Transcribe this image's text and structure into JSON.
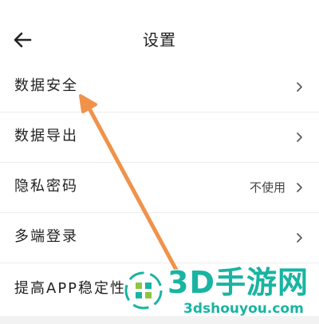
{
  "header": {
    "back_icon": "arrow-left-icon",
    "title": "设置"
  },
  "settings": {
    "items": [
      {
        "label": "数据安全",
        "value": "",
        "icon": "chevron-right-icon"
      },
      {
        "label": "数据导出",
        "value": "",
        "icon": "chevron-right-icon"
      },
      {
        "label": "隐私密码",
        "value": "不使用",
        "icon": "chevron-right-icon"
      },
      {
        "label": "多端登录",
        "value": "",
        "icon": "chevron-right-icon"
      },
      {
        "label": "提高APP稳定性",
        "value": "",
        "icon": "chevron-right-icon"
      }
    ]
  },
  "annotation": {
    "arrow_color": "#f0924a"
  },
  "watermark": {
    "name": "3D手游网",
    "url": "3dshouyou.com",
    "color": "#19b4a2"
  }
}
